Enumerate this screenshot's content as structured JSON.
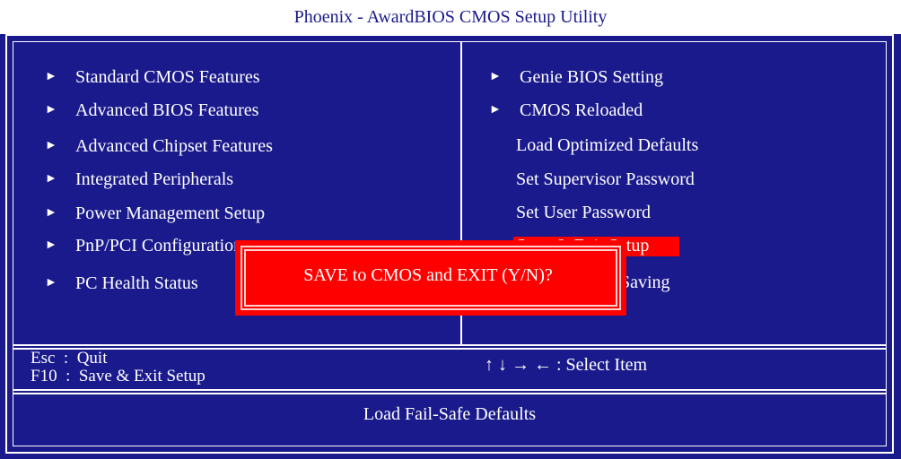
{
  "window": {
    "title": "Phoenix - AwardBIOS CMOS Setup Utility"
  },
  "left_menu": {
    "items": [
      {
        "label": "Standard CMOS Features",
        "icon": "right-triangle-icon"
      },
      {
        "label": "Advanced BIOS Features",
        "icon": "right-triangle-icon"
      },
      {
        "label": "Advanced Chipset Features",
        "icon": "right-triangle-icon"
      },
      {
        "label": "Integrated Peripherals",
        "icon": "right-triangle-icon"
      },
      {
        "label": "Power Management Setup",
        "icon": "right-triangle-icon"
      },
      {
        "label": "PnP/PCI Configurations",
        "icon": "right-triangle-icon"
      },
      {
        "label": "PC Health Status",
        "icon": "right-triangle-icon"
      }
    ]
  },
  "right_menu": {
    "items": [
      {
        "label": "Genie BIOS Setting",
        "icon": "right-triangle-icon"
      },
      {
        "label": "CMOS Reloaded",
        "icon": "right-triangle-icon"
      },
      {
        "label": "Load Optimized Defaults"
      },
      {
        "label": "Set Supervisor Password"
      },
      {
        "label": "Set User Password"
      },
      {
        "label": "Save & Exit Setup",
        "selected": true
      },
      {
        "label": "Saving"
      }
    ]
  },
  "dialog": {
    "message": "SAVE to CMOS and EXIT (Y/N)?"
  },
  "footer": {
    "esc_row": "Esc  :  Quit",
    "f10_row": "F10  :  Save & Exit Setup",
    "nav_hint": "↑ ↓ → ← : Select Item"
  },
  "status_line": "Load Fail-Safe Defaults",
  "colors": {
    "background": "#1a1a8c",
    "text": "#ffffff",
    "highlight": "#ff0000"
  }
}
